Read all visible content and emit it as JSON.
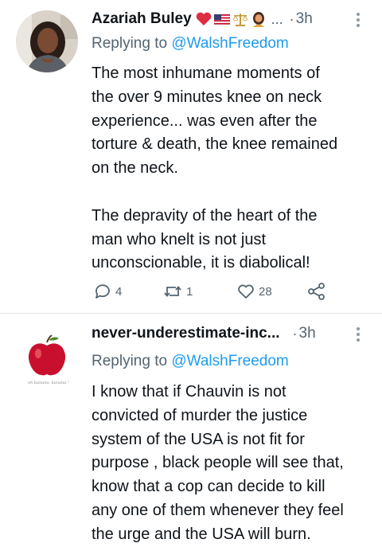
{
  "tweets": [
    {
      "author_name": "Azariah Buley",
      "name_emojis": [
        "heart-emoji",
        "us-flag-emoji",
        "balance-scale-emoji",
        "woman-emoji"
      ],
      "ellipsis": "...",
      "dot": "·",
      "time": "3h",
      "replying_prefix": "Replying to ",
      "replying_handle": "@WalshFreedom",
      "text": "The most inhumane moments of\nthe over 9 minutes knee on neck\nexperience... was even after the\ntorture & death, the knee remained\non the neck.\n\nThe depravity of the heart of the\nman who knelt is not just\nunconscionable, it is diabolical!",
      "replies": "4",
      "retweets": "1",
      "likes": "28"
    },
    {
      "author_name": "never-underestimate-inc...",
      "dot": "·",
      "time": "3h",
      "replying_prefix": "Replying to ",
      "replying_handle": "@WalshFreedom",
      "avatar_caption": "oh banana, banana,\"",
      "text": "I know that if Chauvin is not\nconvicted of murder the justice\nsystem of the USA is not fit for\npurpose , black people will see that,\nknow that a cop can decide to kill\nany one of them whenever they feel\nthe urge and the USA will burn."
    }
  ],
  "colors": {
    "text": "#0f1419",
    "secondary": "#536471",
    "link": "#1d9bf0",
    "divider": "#dfe4e8"
  }
}
